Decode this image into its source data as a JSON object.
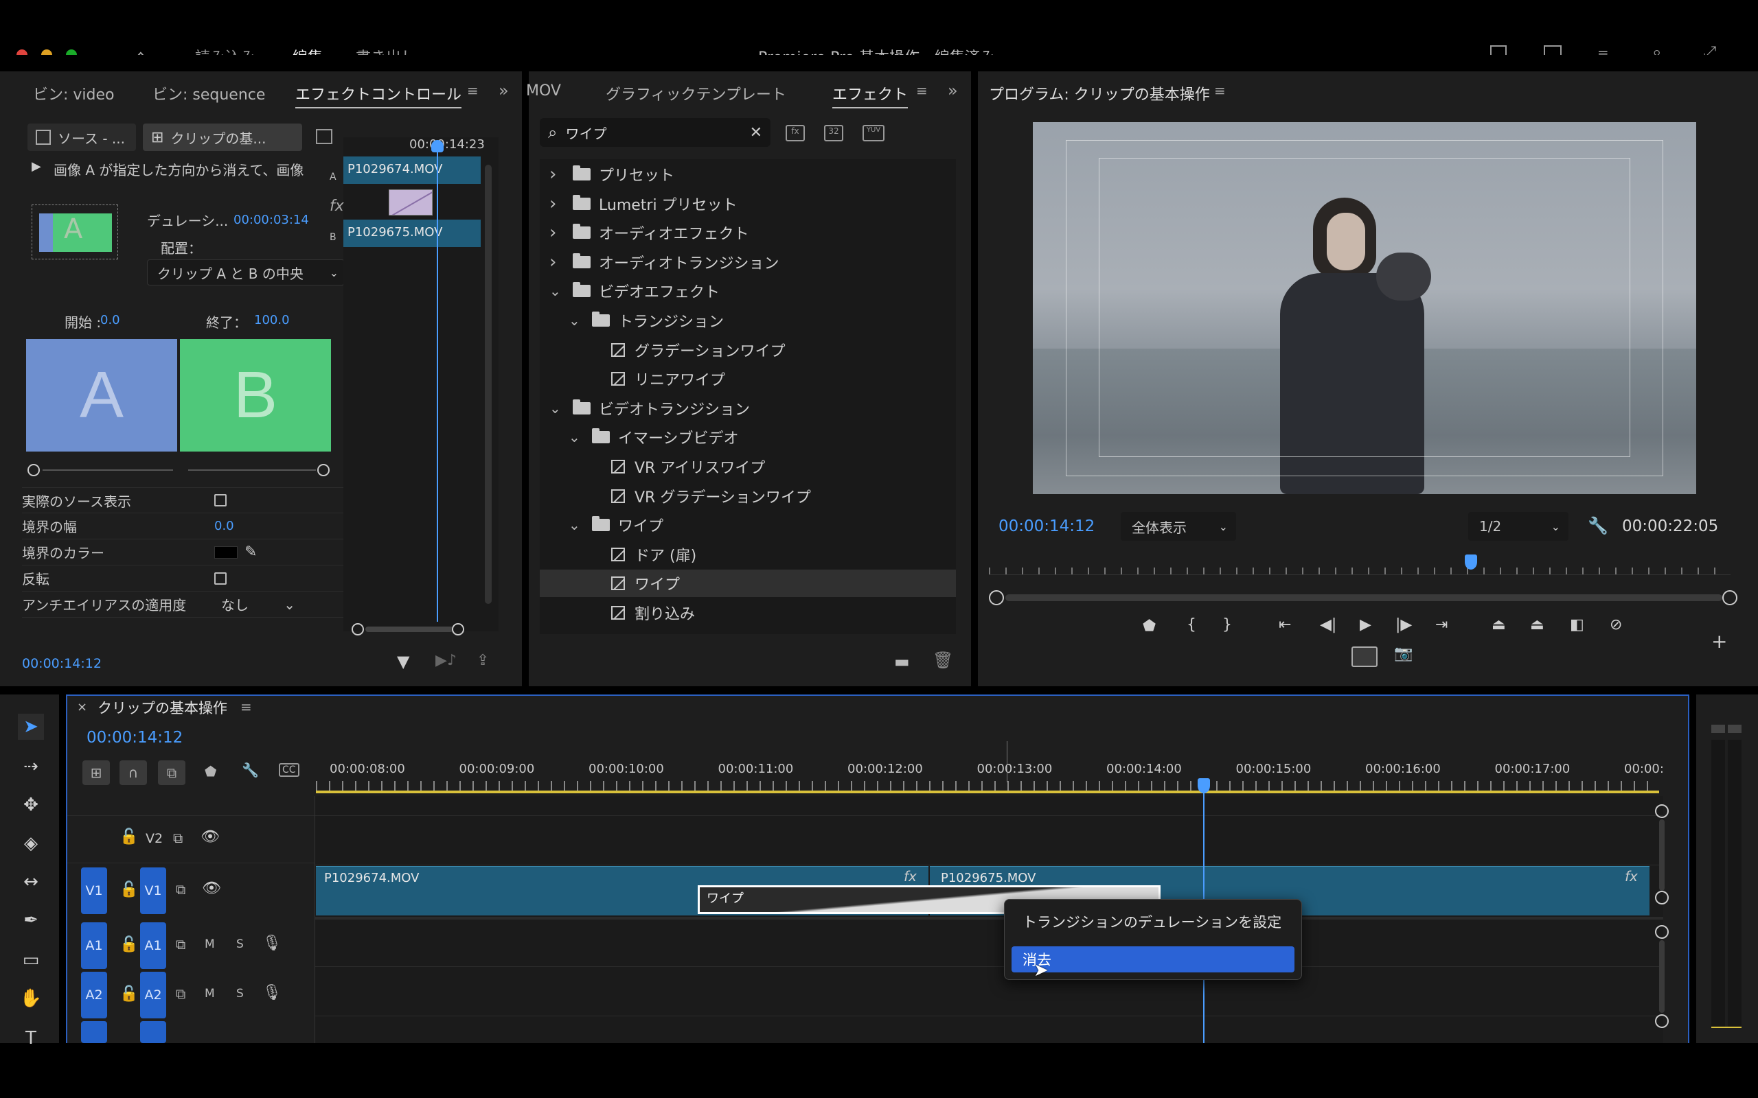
{
  "app": {
    "window_title": "Premiere Pro 基本操作 - 編集済み",
    "nav": [
      "読み込み",
      "編集",
      "書き出し"
    ],
    "active_nav": "編集"
  },
  "left_panel": {
    "tabs": [
      "ビン: video",
      "ビン: sequence",
      "エフェクトコントロール"
    ],
    "source_btn": "ソース - ...",
    "clip_btn": "クリップの基...",
    "description": "画像 A が指定した方向から消えて、画像",
    "duration_label": "デュレーシ...",
    "duration_value": "00:00:03:14",
    "placement_label": "配置：",
    "placement_value": "クリップ A と B の中央",
    "start_label": "開始 :",
    "start_value": "0.0",
    "end_label": "終了：",
    "end_value": "100.0",
    "thumb_a": "A",
    "thumb_b": "B",
    "props": [
      {
        "label": "実際のソース表示",
        "type": "checkbox"
      },
      {
        "label": "境界の幅",
        "value": "0.0"
      },
      {
        "label": "境界のカラー",
        "type": "color"
      },
      {
        "label": "反転",
        "type": "checkbox"
      },
      {
        "label": "アンチエイリアスの適用度",
        "value": "なし"
      }
    ],
    "mini_timecode": "00:00:14:23",
    "clip_top": "P1029674.MOV",
    "clip_bottom": "P1029675.MOV",
    "track_a": "A",
    "track_b": "B",
    "fx_label": "fx",
    "footer_timecode": "00:00:14:12"
  },
  "effects_panel": {
    "tabs": [
      "MOV",
      "グラフィックテンプレート",
      "エフェクト"
    ],
    "search_value": "ワイプ",
    "toolbar_badges": [
      "32",
      "YUV"
    ],
    "tree": [
      {
        "label": "プリセット",
        "indent": 0,
        "kind": "preset",
        "open": false
      },
      {
        "label": "Lumetri プリセット",
        "indent": 0,
        "kind": "preset",
        "open": false
      },
      {
        "label": "オーディオエフェクト",
        "indent": 0,
        "kind": "folder",
        "open": false
      },
      {
        "label": "オーディオトランジション",
        "indent": 0,
        "kind": "folder",
        "open": false
      },
      {
        "label": "ビデオエフェクト",
        "indent": 0,
        "kind": "folder",
        "open": true
      },
      {
        "label": "トランジション",
        "indent": 1,
        "kind": "folder",
        "open": true
      },
      {
        "label": "グラデーションワイプ",
        "indent": 2,
        "kind": "effect"
      },
      {
        "label": "リニアワイプ",
        "indent": 2,
        "kind": "effect"
      },
      {
        "label": "ビデオトランジション",
        "indent": 0,
        "kind": "folder",
        "open": true
      },
      {
        "label": "イマーシブビデオ",
        "indent": 1,
        "kind": "folder",
        "open": true
      },
      {
        "label": "VR アイリスワイプ",
        "indent": 2,
        "kind": "transition"
      },
      {
        "label": "VR グラデーションワイプ",
        "indent": 2,
        "kind": "transition"
      },
      {
        "label": "ワイプ",
        "indent": 1,
        "kind": "folder",
        "open": true
      },
      {
        "label": "ドア (扉)",
        "indent": 2,
        "kind": "transition"
      },
      {
        "label": "ワイプ",
        "indent": 2,
        "kind": "transition",
        "selected": true
      },
      {
        "label": "割り込み",
        "indent": 2,
        "kind": "transition"
      }
    ]
  },
  "program_monitor": {
    "title": "プログラム: クリップの基本操作",
    "current_tc": "00:00:14:12",
    "zoom": "全体表示",
    "resolution": "1/2",
    "duration_tc": "00:00:22:05",
    "playhead_fraction": 0.65
  },
  "timeline": {
    "title": "クリップの基本操作",
    "timecode": "00:00:14:12",
    "ruler": [
      "00:00:08:00",
      "00:00:09:00",
      "00:00:10:00",
      "00:00:11:00",
      "00:00:12:00",
      "00:00:13:00",
      "00:00:14:00",
      "00:00:15:00",
      "00:00:16:00",
      "00:00:17:00",
      "00:00:"
    ],
    "tracks": {
      "v2": "V2",
      "v1": "V1",
      "a1": "A1",
      "a2": "A2",
      "m": "M",
      "s": "S"
    },
    "clip1": "P1029674.MOV",
    "clip2": "P1029675.MOV",
    "transition": "ワイプ",
    "fx_label": "fx"
  },
  "context_menu": {
    "items": [
      "トランジションのデュレーションを設定",
      "消去"
    ],
    "highlighted": "消去"
  },
  "colors": {
    "accent": "#4a9dff",
    "track_blue": "#2361c9",
    "clip_teal": "#1f5c7a",
    "thumb_a": "#6e8fcf",
    "thumb_b": "#4fc87a"
  }
}
